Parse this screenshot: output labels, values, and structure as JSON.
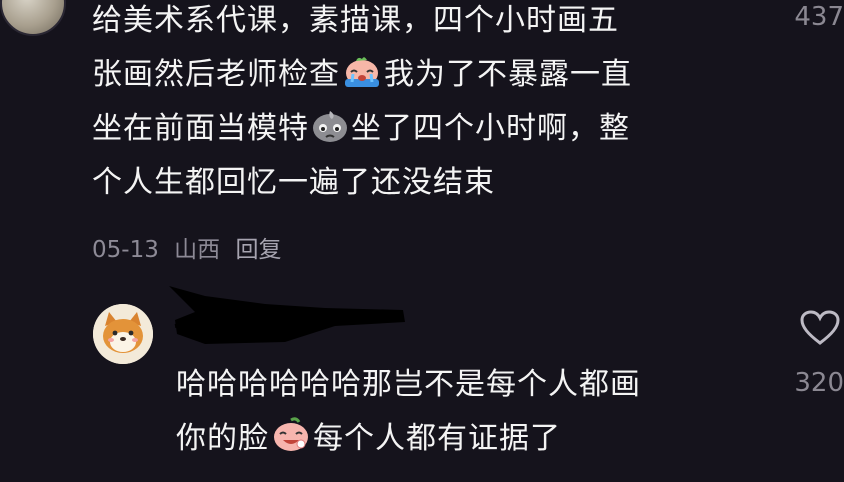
{
  "main_comment": {
    "lines": [
      "给美术系代课，素描课，四个小时画五",
      "张画然后老师检查",
      "我为了不暴露一直",
      "坐在前面当模特",
      "坐了四个小时啊，整",
      "个人生都回忆一遍了还没结束"
    ],
    "date": "05-13",
    "location": "山西",
    "reply_label": "回复",
    "like_count": "437",
    "emojis": [
      "crying-emoji",
      "sweat-emoji"
    ]
  },
  "reply_comment": {
    "lines": [
      "哈哈哈哈哈哈那岂不是每个人都画",
      "你的脸",
      "每个人都有证据了"
    ],
    "like_count": "320",
    "emojis": [
      "laughing-peach-emoji"
    ],
    "avatar": "shiba-dog-avatar"
  },
  "icons": {
    "like": "heart-outline-icon"
  }
}
